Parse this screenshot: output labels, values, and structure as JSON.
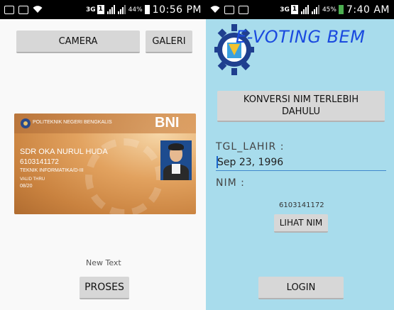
{
  "left_screen": {
    "statusbar": {
      "network": "3G",
      "sim": "1",
      "battery_percent": "44%",
      "time": "10:56 PM"
    },
    "camera_button": "CAMERA",
    "gallery_button": "GALERI",
    "id_card": {
      "institution": "POLITEKNIK NEGERI BENGKALIS",
      "bank": "BNI",
      "name": "SDR OKA NURUL HUDA",
      "number": "6103141172",
      "program": "TEKNIK INFORMATIKA/D-III",
      "valid_label": "VALID THRU",
      "valid_date": "08/20"
    },
    "result_text": "New Text",
    "process_button": "PROSES"
  },
  "right_screen": {
    "statusbar": {
      "network": "3G",
      "sim": "1",
      "battery_percent": "45%",
      "time": "7:40 AM"
    },
    "app_title": "E-VOTING BEM",
    "convert_button": "KONVERSI NIM TERLEBIH DAHULU",
    "dob_label": "TGL_LAHIR :",
    "dob_value": "Sep 23, 1996",
    "nim_label": "NIM  :",
    "nim_value": "6103141172",
    "view_nim_button": "LIHAT NIM",
    "login_button": "LOGIN"
  },
  "colors": {
    "right_background": "#a8dcec",
    "button": "#d7d7d7",
    "title": "#1a4adf",
    "statusbar": "#000000"
  }
}
